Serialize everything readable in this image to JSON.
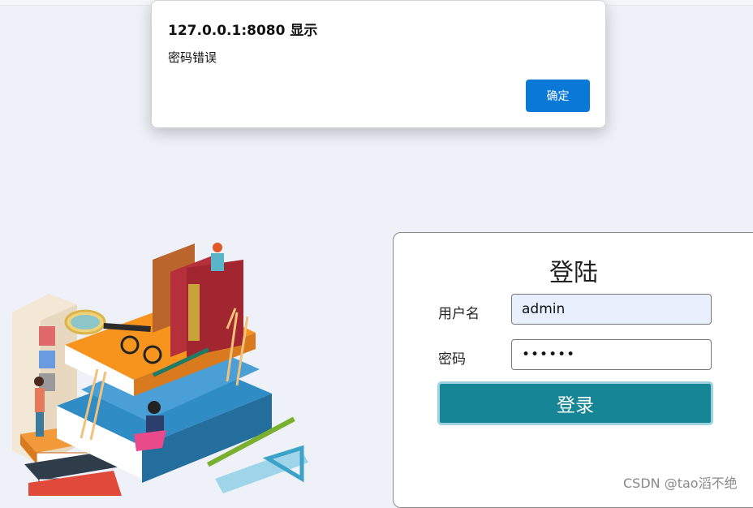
{
  "alert": {
    "title": "127.0.0.1:8080 显示",
    "message": "密码错误",
    "ok_label": "确定"
  },
  "login": {
    "title": "登陆",
    "username_label": "用户名",
    "username_value": "admin",
    "password_label": "密码",
    "password_value": "••••••",
    "submit_label": "登录",
    "accent_color": "#168696"
  },
  "watermark": "CSDN @tao滔不绝"
}
